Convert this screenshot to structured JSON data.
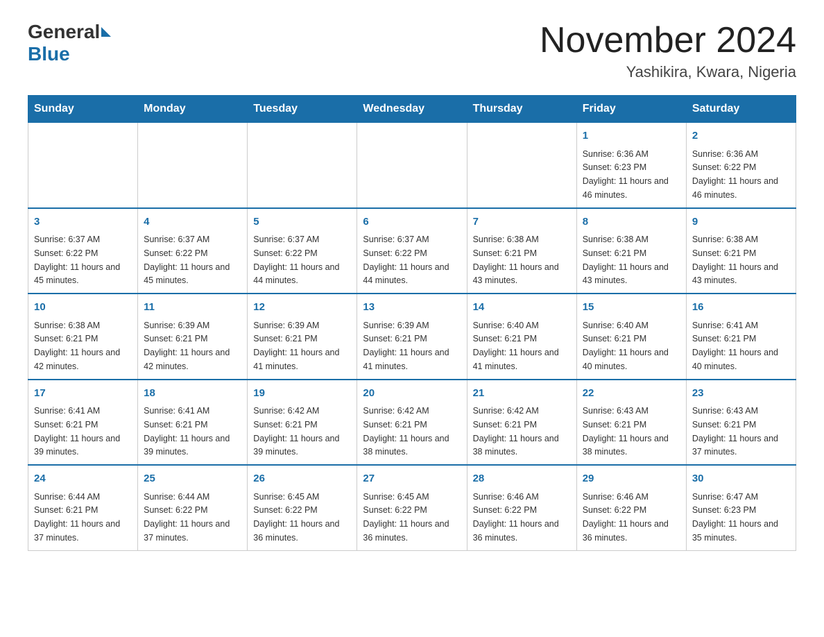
{
  "header": {
    "title": "November 2024",
    "location": "Yashikira, Kwara, Nigeria",
    "logo_general": "General",
    "logo_blue": "Blue"
  },
  "days_of_week": [
    "Sunday",
    "Monday",
    "Tuesday",
    "Wednesday",
    "Thursday",
    "Friday",
    "Saturday"
  ],
  "weeks": [
    [
      {
        "day": "",
        "info": ""
      },
      {
        "day": "",
        "info": ""
      },
      {
        "day": "",
        "info": ""
      },
      {
        "day": "",
        "info": ""
      },
      {
        "day": "",
        "info": ""
      },
      {
        "day": "1",
        "info": "Sunrise: 6:36 AM\nSunset: 6:23 PM\nDaylight: 11 hours and 46 minutes."
      },
      {
        "day": "2",
        "info": "Sunrise: 6:36 AM\nSunset: 6:22 PM\nDaylight: 11 hours and 46 minutes."
      }
    ],
    [
      {
        "day": "3",
        "info": "Sunrise: 6:37 AM\nSunset: 6:22 PM\nDaylight: 11 hours and 45 minutes."
      },
      {
        "day": "4",
        "info": "Sunrise: 6:37 AM\nSunset: 6:22 PM\nDaylight: 11 hours and 45 minutes."
      },
      {
        "day": "5",
        "info": "Sunrise: 6:37 AM\nSunset: 6:22 PM\nDaylight: 11 hours and 44 minutes."
      },
      {
        "day": "6",
        "info": "Sunrise: 6:37 AM\nSunset: 6:22 PM\nDaylight: 11 hours and 44 minutes."
      },
      {
        "day": "7",
        "info": "Sunrise: 6:38 AM\nSunset: 6:21 PM\nDaylight: 11 hours and 43 minutes."
      },
      {
        "day": "8",
        "info": "Sunrise: 6:38 AM\nSunset: 6:21 PM\nDaylight: 11 hours and 43 minutes."
      },
      {
        "day": "9",
        "info": "Sunrise: 6:38 AM\nSunset: 6:21 PM\nDaylight: 11 hours and 43 minutes."
      }
    ],
    [
      {
        "day": "10",
        "info": "Sunrise: 6:38 AM\nSunset: 6:21 PM\nDaylight: 11 hours and 42 minutes."
      },
      {
        "day": "11",
        "info": "Sunrise: 6:39 AM\nSunset: 6:21 PM\nDaylight: 11 hours and 42 minutes."
      },
      {
        "day": "12",
        "info": "Sunrise: 6:39 AM\nSunset: 6:21 PM\nDaylight: 11 hours and 41 minutes."
      },
      {
        "day": "13",
        "info": "Sunrise: 6:39 AM\nSunset: 6:21 PM\nDaylight: 11 hours and 41 minutes."
      },
      {
        "day": "14",
        "info": "Sunrise: 6:40 AM\nSunset: 6:21 PM\nDaylight: 11 hours and 41 minutes."
      },
      {
        "day": "15",
        "info": "Sunrise: 6:40 AM\nSunset: 6:21 PM\nDaylight: 11 hours and 40 minutes."
      },
      {
        "day": "16",
        "info": "Sunrise: 6:41 AM\nSunset: 6:21 PM\nDaylight: 11 hours and 40 minutes."
      }
    ],
    [
      {
        "day": "17",
        "info": "Sunrise: 6:41 AM\nSunset: 6:21 PM\nDaylight: 11 hours and 39 minutes."
      },
      {
        "day": "18",
        "info": "Sunrise: 6:41 AM\nSunset: 6:21 PM\nDaylight: 11 hours and 39 minutes."
      },
      {
        "day": "19",
        "info": "Sunrise: 6:42 AM\nSunset: 6:21 PM\nDaylight: 11 hours and 39 minutes."
      },
      {
        "day": "20",
        "info": "Sunrise: 6:42 AM\nSunset: 6:21 PM\nDaylight: 11 hours and 38 minutes."
      },
      {
        "day": "21",
        "info": "Sunrise: 6:42 AM\nSunset: 6:21 PM\nDaylight: 11 hours and 38 minutes."
      },
      {
        "day": "22",
        "info": "Sunrise: 6:43 AM\nSunset: 6:21 PM\nDaylight: 11 hours and 38 minutes."
      },
      {
        "day": "23",
        "info": "Sunrise: 6:43 AM\nSunset: 6:21 PM\nDaylight: 11 hours and 37 minutes."
      }
    ],
    [
      {
        "day": "24",
        "info": "Sunrise: 6:44 AM\nSunset: 6:21 PM\nDaylight: 11 hours and 37 minutes."
      },
      {
        "day": "25",
        "info": "Sunrise: 6:44 AM\nSunset: 6:22 PM\nDaylight: 11 hours and 37 minutes."
      },
      {
        "day": "26",
        "info": "Sunrise: 6:45 AM\nSunset: 6:22 PM\nDaylight: 11 hours and 36 minutes."
      },
      {
        "day": "27",
        "info": "Sunrise: 6:45 AM\nSunset: 6:22 PM\nDaylight: 11 hours and 36 minutes."
      },
      {
        "day": "28",
        "info": "Sunrise: 6:46 AM\nSunset: 6:22 PM\nDaylight: 11 hours and 36 minutes."
      },
      {
        "day": "29",
        "info": "Sunrise: 6:46 AM\nSunset: 6:22 PM\nDaylight: 11 hours and 36 minutes."
      },
      {
        "day": "30",
        "info": "Sunrise: 6:47 AM\nSunset: 6:23 PM\nDaylight: 11 hours and 35 minutes."
      }
    ]
  ]
}
